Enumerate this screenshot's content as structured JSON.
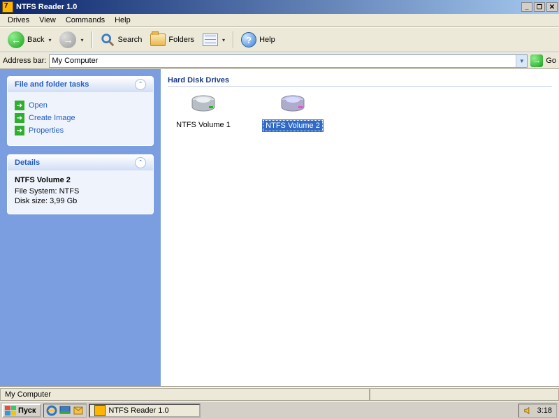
{
  "window": {
    "title": "NTFS Reader 1.0"
  },
  "menu": {
    "items": [
      "Drives",
      "View",
      "Commands",
      "Help"
    ]
  },
  "toolbar": {
    "back": "Back",
    "search": "Search",
    "folders": "Folders",
    "help": "Help"
  },
  "address": {
    "label": "Address bar:",
    "value": "My Computer",
    "go": "Go"
  },
  "sidebar": {
    "tasks_title": "File and folder tasks",
    "tasks": [
      {
        "label": "Open"
      },
      {
        "label": "Create Image"
      },
      {
        "label": "Properties"
      }
    ],
    "details_title": "Details",
    "details": {
      "name": "NTFS Volume 2",
      "fs": "File System: NTFS",
      "size": "Disk size: 3,99 Gb"
    }
  },
  "content": {
    "section": "Hard Disk Drives",
    "drives": [
      {
        "label": "NTFS Volume 1",
        "selected": false
      },
      {
        "label": "NTFS Volume 2",
        "selected": true
      }
    ]
  },
  "statusbar": {
    "text": "My Computer"
  },
  "taskbar": {
    "start": "Пуск",
    "task_button": "NTFS Reader 1.0",
    "clock": "3:18"
  }
}
